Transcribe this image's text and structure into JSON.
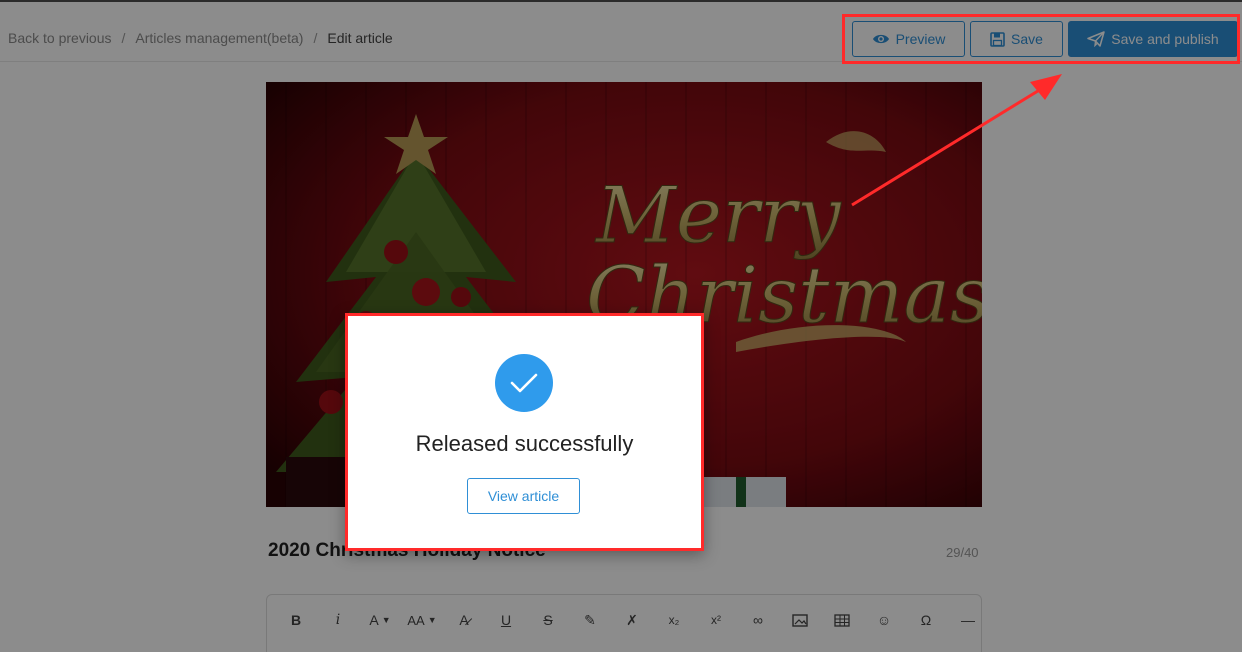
{
  "breadcrumb": {
    "back": "Back to previous",
    "section": "Articles management(beta)",
    "current": "Edit article",
    "separator": "/"
  },
  "actions": {
    "preview_label": "Preview",
    "save_label": "Save",
    "publish_label": "Save and publish"
  },
  "banner": {
    "line1": "Merry",
    "line2": "Christmas"
  },
  "article": {
    "title": "2020 Christmas Holiday Notice",
    "counter": "29/40"
  },
  "toolbar": {
    "bold": "B",
    "italic": "i",
    "font_color": "A",
    "font_size": "AA",
    "underline": "U",
    "strikethrough": "S",
    "subscript": "x₂",
    "superscript": "x²",
    "special_char": "Ω",
    "hr": "—"
  },
  "modal": {
    "title": "Released successfully",
    "view_label": "View article"
  },
  "colors": {
    "accent": "#2f8fd6",
    "annotation": "#ff2a2a",
    "success": "#2f9bec"
  }
}
